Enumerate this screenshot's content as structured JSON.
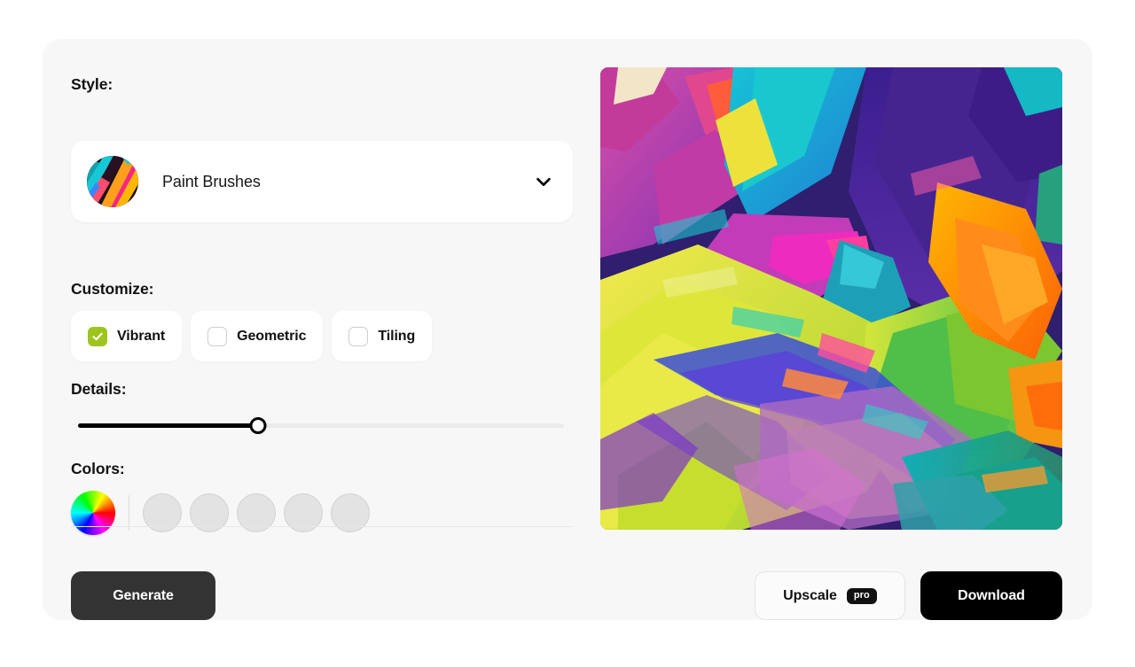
{
  "panel": {
    "style": {
      "label": "Style:",
      "selected": "Paint Brushes",
      "thumbnail_icon": "paint-brushes-thumbnail",
      "chevron_icon": "chevron-down-icon"
    },
    "customize": {
      "label": "Customize:",
      "options": [
        {
          "label": "Vibrant",
          "checked": true
        },
        {
          "label": "Geometric",
          "checked": false
        },
        {
          "label": "Tiling",
          "checked": false
        }
      ],
      "checked_color": "#9dc51e"
    },
    "details": {
      "label": "Details:",
      "value_percent": 37
    },
    "colors": {
      "label": "Colors:",
      "wheel_icon": "color-wheel-icon",
      "swatch_count": 5,
      "swatch_color": "#e3e3e3"
    },
    "generate": {
      "label": "Generate",
      "background": "#333333"
    }
  },
  "preview": {
    "image_alt": "abstract-paint-artwork",
    "actions": {
      "upscale": {
        "label": "Upscale",
        "badge": "pro"
      },
      "download": {
        "label": "Download",
        "background": "#000000"
      }
    }
  }
}
